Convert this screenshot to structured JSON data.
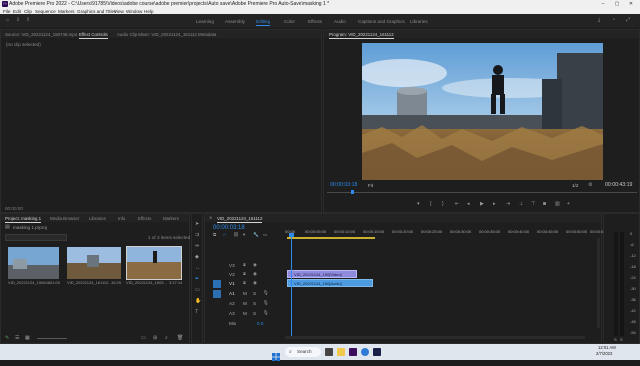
{
  "window": {
    "title": "Adobe Premiere Pro 2022 - C:\\Users\\91785\\Videos\\adobe course\\adobe premier\\projects\\Auto save\\Adobe Premiere Pro Auto-Save\\masking 1 *",
    "app_icon": "Pr"
  },
  "menu": [
    "File",
    "Edit",
    "Clip",
    "Sequence",
    "Markers",
    "Graphics and Titles",
    "View",
    "Window",
    "Help"
  ],
  "workspaces": [
    "Learning",
    "Assembly",
    "Editing",
    "Color",
    "Effects",
    "Audio",
    "Captions and Graphics",
    "Libraries"
  ],
  "active_workspace": "Editing",
  "source_panel": {
    "tabs": [
      "Source: VID_20221124_150748.mp4",
      "Effect Controls",
      "Audio Clip Mixer: VID_20221124_161112",
      "Metadata"
    ],
    "active_tab": "Effect Controls",
    "message": "(no clip selected)",
    "timecode": "00:00:00"
  },
  "program": {
    "title": "Program: VID_20221124_161112",
    "timecode": "00:00:03:18",
    "fit": "Fit",
    "quality": "1/2",
    "duration": "00:00:43:19"
  },
  "project_panel": {
    "tabs": [
      "Project: masking 1",
      "Media Browser",
      "Libraries",
      "Info",
      "Effects",
      "Markers"
    ],
    "active_tab": "Project: masking 1",
    "project_name": "masking 1.prproj",
    "selection_info": "1 of 3 items selected",
    "items": [
      {
        "name": "VID_20221124_150648...",
        "duration": "21:00"
      },
      {
        "name": "VID_20221124_161112...",
        "duration": "15:29"
      },
      {
        "name": "VID_20221124_1603...",
        "duration": "3:17:14"
      }
    ]
  },
  "timeline": {
    "sequence_tab": "VID_20221124_161112",
    "timecode": "00:00:03:18",
    "ruler": [
      "00:00",
      "00:00:05:00",
      "00:00:10:00",
      "00:00:15:00",
      "00:00:20:00",
      "00:00:25:00",
      "00:00:30:00",
      "00:00:35:00",
      "00:00:40:00",
      "00:00:45:00",
      "00:00:50:00",
      "00:00:55:00"
    ],
    "video_tracks": [
      "V3",
      "V2",
      "V1"
    ],
    "audio_tracks": [
      "A1",
      "A2",
      "A3"
    ],
    "clips": [
      {
        "track": "V1",
        "label": "VID_20221124_150[Video]"
      },
      {
        "track": "A1",
        "label": "VID_20221124_150[Audio]"
      }
    ],
    "mix_label": "Mix",
    "mix_value": "0.0"
  },
  "meter_labels": [
    "0",
    "-6",
    "-12",
    "-18",
    "-24",
    "-30",
    "-36",
    "-42",
    "-48",
    "-54"
  ],
  "meter_footer": [
    "S",
    "S"
  ],
  "taskbar": {
    "search": "Search",
    "time": "12:01 AM",
    "date": "2/7/2023"
  },
  "colors": {
    "accent": "#2d8ceb",
    "video_clip": "#8e8bdf",
    "audio_clip": "#4d9be0"
  }
}
